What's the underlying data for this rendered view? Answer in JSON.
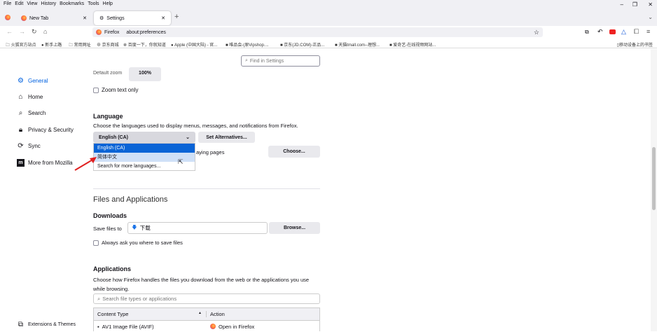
{
  "menu": [
    "File",
    "Edit",
    "View",
    "History",
    "Bookmarks",
    "Tools",
    "Help"
  ],
  "tabs": [
    {
      "label": "New Tab"
    },
    {
      "label": "Settings"
    }
  ],
  "url": {
    "identity": "Firefox",
    "address": "about:preferences"
  },
  "bookmarks": [
    "火狐官方站点",
    "新手上路",
    "常用网址",
    "京东商城",
    "百度一下，你就知道",
    "Apple (中国大陆) - 官...",
    "唯品会-(原Vipshop....",
    "京东(JD.COM)-正品...",
    "天猫tmall.com--理想...",
    "爱奇艺-在线视频网站..."
  ],
  "mobile_bookmarks": "移动设备上的书签",
  "search_placeholder": "Find in Settings",
  "sidebar": {
    "items": [
      {
        "label": "General",
        "icon": "gear-icon"
      },
      {
        "label": "Home",
        "icon": "home-icon"
      },
      {
        "label": "Search",
        "icon": "search-icon"
      },
      {
        "label": "Privacy & Security",
        "icon": "lock-icon"
      },
      {
        "label": "Sync",
        "icon": "sync-icon"
      },
      {
        "label": "More from Mozilla",
        "icon": "mozilla-icon"
      }
    ],
    "footer": "Extensions & Themes",
    "accent": "#0061e0"
  },
  "zoom": {
    "label": "Default zoom",
    "value": "100%",
    "text_only": "Zoom text only"
  },
  "language": {
    "title": "Language",
    "desc": "Choose the languages used to display menus, messages, and notifications from Firefox.",
    "selected": "English (CA)",
    "set_alt": "Set Alternatives...",
    "options": [
      "English (CA)",
      "简体中文",
      "Search for more languages..."
    ],
    "pages_partial": "aying pages",
    "choose": "Choose..."
  },
  "files": {
    "title": "Files and Applications",
    "downloads": "Downloads",
    "save_to": "Save files to",
    "folder": "下载",
    "browse": "Browse...",
    "always_ask": "Always ask you where to save files"
  },
  "apps": {
    "title": "Applications",
    "desc": "Choose how Firefox handles the files you download from the web or the applications you use while browsing.",
    "search_placeholder": "Search file types or applications",
    "col_type": "Content Type",
    "col_action": "Action",
    "rows": [
      {
        "type": "AV1 Image File (AVIF)",
        "action": "Open in Firefox"
      }
    ]
  }
}
